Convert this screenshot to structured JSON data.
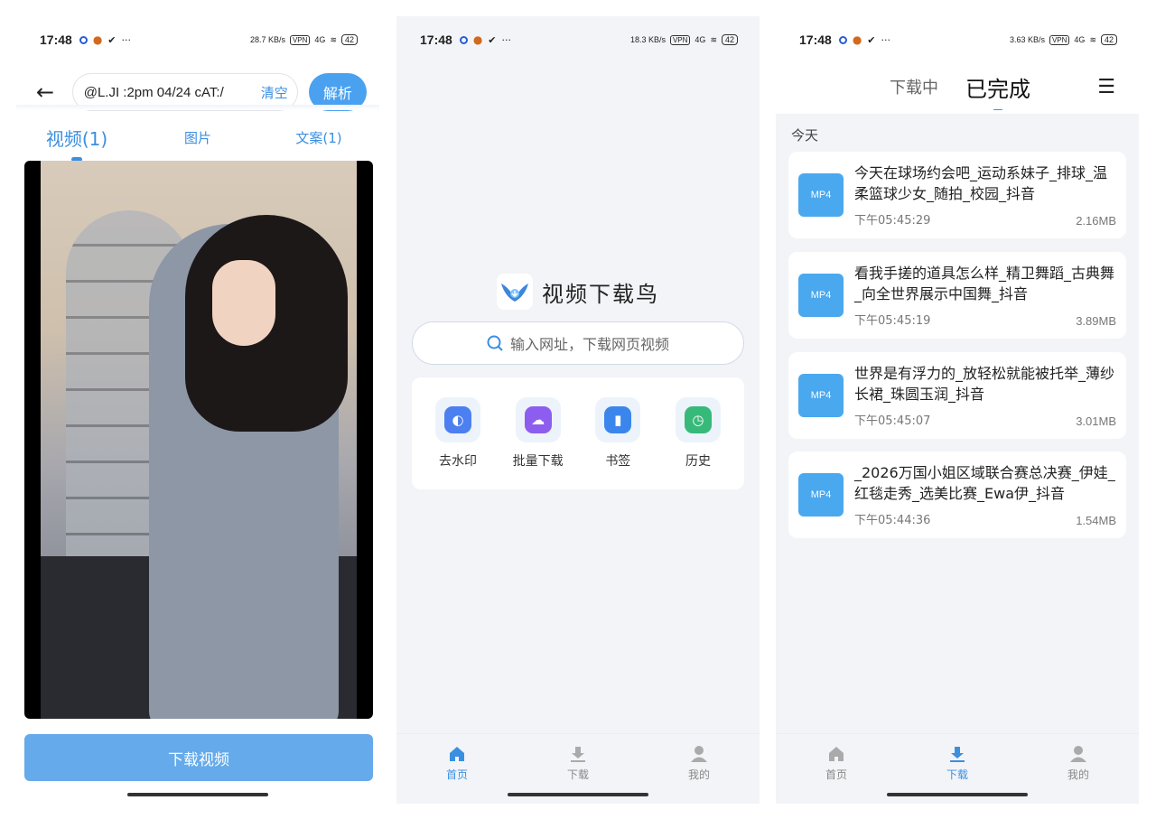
{
  "status": {
    "time": "17:48",
    "net_speed_1": "28.7 KB/s",
    "net_speed_2": "18.3 KB/s",
    "net_speed_3": "3.63 KB/s",
    "vpn": "VPN",
    "signal": "4G",
    "battery": "42"
  },
  "parse_screen": {
    "url_value": "@L.JI :2pm 04/24 cAT:/",
    "clear_label": "清空",
    "parse_label": "解析",
    "tabs": [
      {
        "label": "视频(1)",
        "active": true
      },
      {
        "label": "图片",
        "active": false
      },
      {
        "label": "文案(1)",
        "active": false
      }
    ],
    "download_button": "下载视频"
  },
  "home_screen": {
    "app_name": "视频下载鸟",
    "search_placeholder": "输入网址，下载网页视频",
    "tools": [
      {
        "label": "去水印",
        "icon": "water-drop-icon",
        "color": "#4c7ff0"
      },
      {
        "label": "批量下载",
        "icon": "cloud-download-icon",
        "color": "#8d5df0"
      },
      {
        "label": "书签",
        "icon": "bookmark-icon",
        "color": "#3b86ec"
      },
      {
        "label": "历史",
        "icon": "history-icon",
        "color": "#37b97a"
      }
    ]
  },
  "downloads_screen": {
    "tabs": {
      "downloading": "下载中",
      "completed": "已完成"
    },
    "section": "今天",
    "items": [
      {
        "badge": "MP4",
        "title": "今天在球场约会吧_运动系妹子_排球_温柔篮球少女_随拍_校园_抖音",
        "time": "下午05:45:29",
        "size": "2.16MB"
      },
      {
        "badge": "MP4",
        "title": "看我手搓的道具怎么样_精卫舞蹈_古典舞_向全世界展示中国舞_抖音",
        "time": "下午05:45:19",
        "size": "3.89MB"
      },
      {
        "badge": "MP4",
        "title": "世界是有浮力的_放轻松就能被托举_薄纱长裙_珠圆玉润_抖音",
        "time": "下午05:45:07",
        "size": "3.01MB"
      },
      {
        "badge": "MP4",
        "title": "_2026万国小姐区域联合赛总决赛_伊娃_红毯走秀_选美比赛_Ewa伊_抖音",
        "time": "下午05:44:36",
        "size": "1.54MB"
      }
    ]
  },
  "nav": {
    "home": "首页",
    "download": "下载",
    "mine": "我的"
  },
  "colors": {
    "accent": "#3b8fe0",
    "button": "#4aa1f0",
    "badge": "#4aa8ef"
  }
}
